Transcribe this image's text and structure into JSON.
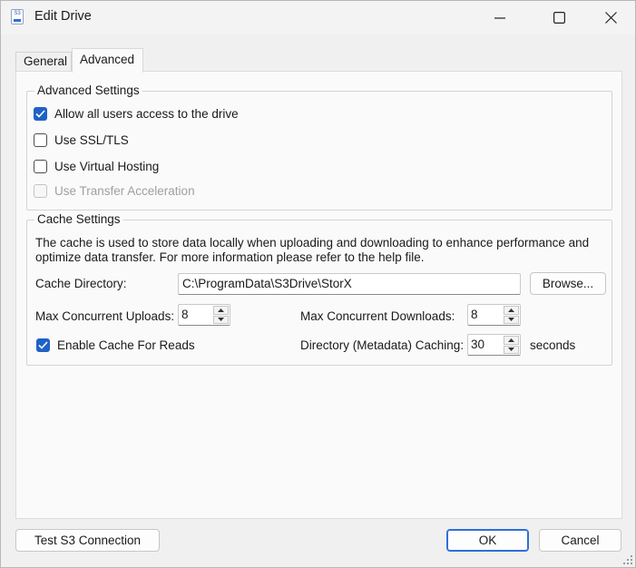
{
  "window": {
    "title": "Edit Drive",
    "app_icon_text": "S3"
  },
  "tabs": [
    {
      "label": "General"
    },
    {
      "label": "Advanced"
    }
  ],
  "advanced_settings": {
    "title": "Advanced Settings",
    "options": [
      {
        "label": "Allow all users access to the drive",
        "checked": true,
        "enabled": true
      },
      {
        "label": "Use SSL/TLS",
        "checked": false,
        "enabled": true
      },
      {
        "label": "Use Virtual Hosting",
        "checked": false,
        "enabled": true
      },
      {
        "label": "Use Transfer Acceleration",
        "checked": false,
        "enabled": false
      }
    ]
  },
  "cache_settings": {
    "title": "Cache Settings",
    "description": "The cache is used to store data locally when uploading and downloading to enhance performance and optimize data transfer. For more information please refer to the help file.",
    "directory_label": "Cache Directory:",
    "directory_value": "C:\\ProgramData\\S3Drive\\StorX",
    "browse_label": "Browse...",
    "max_uploads_label": "Max Concurrent Uploads:",
    "max_uploads_value": "8",
    "max_downloads_label": "Max Concurrent Downloads:",
    "max_downloads_value": "8",
    "enable_cache_reads_label": "Enable Cache For Reads",
    "enable_cache_reads_checked": true,
    "metadata_caching_label": "Directory (Metadata) Caching:",
    "metadata_caching_value": "30",
    "metadata_caching_unit": "seconds"
  },
  "footer": {
    "test_label": "Test S3 Connection",
    "ok_label": "OK",
    "cancel_label": "Cancel"
  },
  "colors": {
    "accent": "#1f62c6",
    "background": "#f0f0f0",
    "panel": "#fafafa"
  }
}
